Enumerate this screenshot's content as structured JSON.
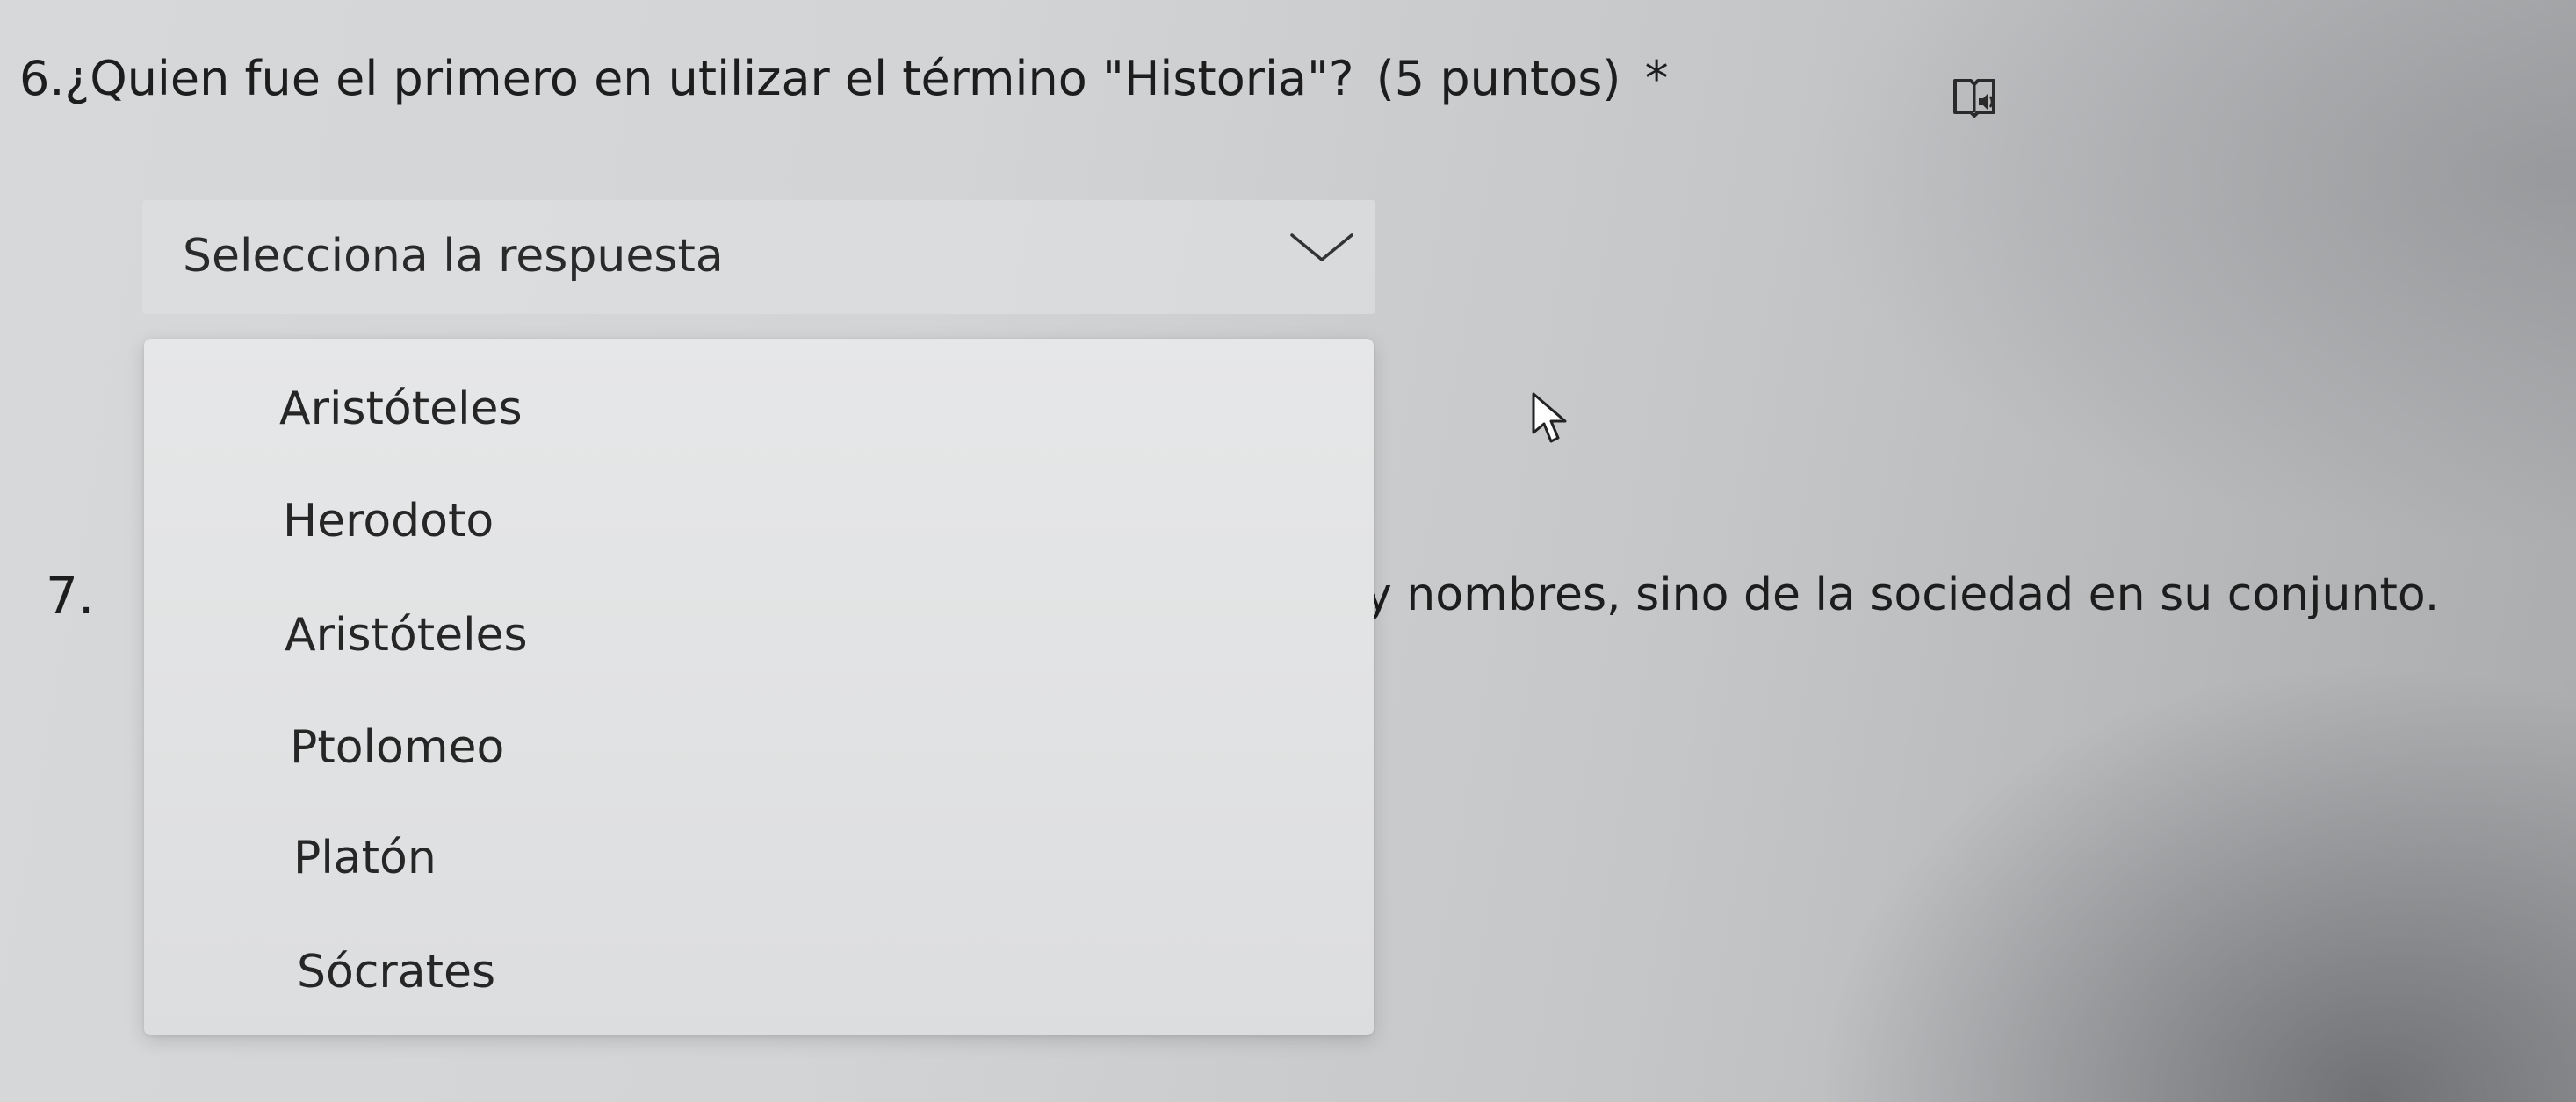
{
  "question6": {
    "number": "6.",
    "text": "¿Quien fue el primero en utilizar el término \"Historia\"?",
    "points": "(5 puntos)",
    "required_marker": "*",
    "immersive_reader_icon": "immersive-reader-icon"
  },
  "dropdown": {
    "placeholder": "Selecciona la respuesta",
    "chevron_icon": "chevron-down-icon",
    "state": "expanded",
    "options": [
      {
        "label": "Aristóteles"
      },
      {
        "label": "Herodoto"
      },
      {
        "label": "Aristóteles"
      },
      {
        "label": "Ptolomeo"
      },
      {
        "label": "Platón"
      },
      {
        "label": "Sócrates"
      }
    ]
  },
  "question7": {
    "number": "7.",
    "visible_text": "y nombres, sino de la sociedad en su conjunto."
  },
  "cursor": {
    "icon": "mouse-pointer-icon"
  }
}
